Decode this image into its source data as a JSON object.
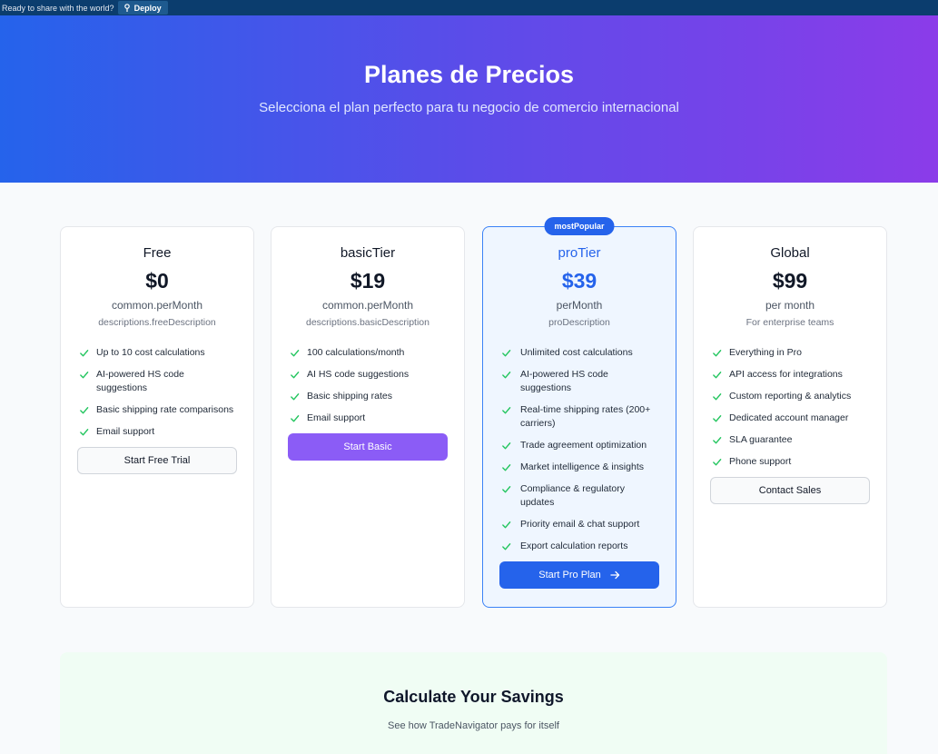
{
  "topbar": {
    "ready_text": "Ready to share with the world?",
    "deploy_label": "Deploy"
  },
  "hero": {
    "title": "Planes de Precios",
    "subtitle": "Selecciona el plan perfecto para tu negocio de comercio internacional"
  },
  "plans": [
    {
      "name": "Free",
      "price": "$0",
      "period": "common.perMonth",
      "description": "descriptions.freeDescription",
      "features": [
        "Up to 10 cost calculations",
        "AI-powered HS code suggestions",
        "Basic shipping rate comparisons",
        "Email support"
      ],
      "cta": "Start Free Trial"
    },
    {
      "name": "basicTier",
      "price": "$19",
      "period": "common.perMonth",
      "description": "descriptions.basicDescription",
      "features": [
        "100 calculations/month",
        "AI HS code suggestions",
        "Basic shipping rates",
        "Email support"
      ],
      "cta": "Start Basic"
    },
    {
      "badge": "mostPopular",
      "name": "proTier",
      "price": "$39",
      "period": "perMonth",
      "description": "proDescription",
      "features": [
        "Unlimited cost calculations",
        "AI-powered HS code suggestions",
        "Real-time shipping rates (200+ carriers)",
        "Trade agreement optimization",
        "Market intelligence & insights",
        "Compliance & regulatory updates",
        "Priority email & chat support",
        "Export calculation reports"
      ],
      "cta": "Start Pro Plan"
    },
    {
      "name": "Global",
      "price": "$99",
      "period": "per month",
      "description": "For enterprise teams",
      "features": [
        "Everything in Pro",
        "API access for integrations",
        "Custom reporting & analytics",
        "Dedicated account manager",
        "SLA guarantee",
        "Phone support"
      ],
      "cta": "Contact Sales"
    }
  ],
  "savings": {
    "title": "Calculate Your Savings",
    "subtitle": "See how TradeNavigator pays for itself"
  },
  "colors": {
    "accent": "#2563eb",
    "purple": "#8b5cf6",
    "check": "#22c55e"
  }
}
